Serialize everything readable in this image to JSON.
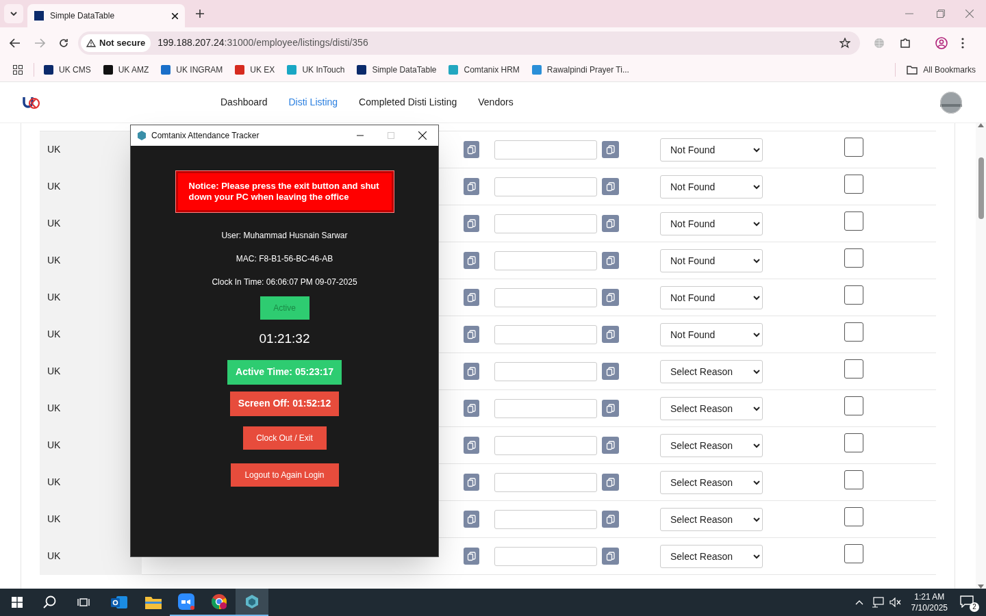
{
  "browser": {
    "tabs": [
      {
        "title": "Simple DataTable",
        "selected": true
      }
    ],
    "address": {
      "security": "Not secure",
      "host": "199.188.207.24",
      "path": ":31000/employee/listings/disti/356"
    },
    "bookmarks": [
      {
        "label": "UK CMS",
        "color": "#0b2a6b"
      },
      {
        "label": "UK AMZ",
        "color": "#111111"
      },
      {
        "label": "UK INGRAM",
        "color": "#1a6fc9"
      },
      {
        "label": "UK EX",
        "color": "#d62b1f"
      },
      {
        "label": "UK InTouch",
        "color": "#19a7c4"
      },
      {
        "label": "Simple DataTable",
        "color": "#0b2a6b"
      },
      {
        "label": "Comtanix HRM",
        "color": "#23a7c0"
      },
      {
        "label": "Rawalpindi Prayer Ti...",
        "color": "#2a8fd8"
      }
    ],
    "all_bookmarks": "All Bookmarks"
  },
  "nav": {
    "links": [
      {
        "label": "Dashboard",
        "selected": false
      },
      {
        "label": "Disti Listing",
        "selected": true
      },
      {
        "label": "Completed Disti Listing",
        "selected": false
      },
      {
        "label": "Vendors",
        "selected": false
      }
    ]
  },
  "rows": [
    {
      "country": "UK",
      "reason": "Not Found",
      "checked": false
    },
    {
      "country": "UK",
      "reason": "Not Found",
      "checked": false
    },
    {
      "country": "UK",
      "reason": "Not Found",
      "checked": false
    },
    {
      "country": "UK",
      "reason": "Not Found",
      "checked": false
    },
    {
      "country": "UK",
      "reason": "Not Found",
      "checked": false
    },
    {
      "country": "UK",
      "reason": "Not Found",
      "checked": false
    },
    {
      "country": "UK",
      "reason": "Select Reason",
      "checked": false
    },
    {
      "country": "UK",
      "reason": "Select Reason",
      "checked": false
    },
    {
      "country": "UK",
      "reason": "Select Reason",
      "checked": false
    },
    {
      "country": "UK",
      "reason": "Select Reason",
      "checked": false
    },
    {
      "country": "UK",
      "reason": "Select Reason",
      "checked": false
    },
    {
      "country": "UK",
      "reason": "Select Reason",
      "checked": false
    }
  ],
  "tracker": {
    "title": "Comtanix Attendance Tracker",
    "notice": "Notice: Please press the exit button and shut down your PC when leaving the office",
    "user": "User: Muhammad Husnain Sarwar",
    "mac": "MAC: F8-B1-56-BC-46-AB",
    "clock_in": "Clock In Time: 06:06:07 PM 09-07-2025",
    "status": "Active",
    "timer": "01:21:32",
    "active_time": "Active Time: 05:23:17",
    "screen_off": "Screen Off: 01:52:12",
    "buttons": [
      "Clock Out / Exit",
      "Logout to Again Login"
    ]
  },
  "taskbar": {
    "time": "1:21 AM",
    "date": "7/10/2025",
    "notifications": "2"
  }
}
